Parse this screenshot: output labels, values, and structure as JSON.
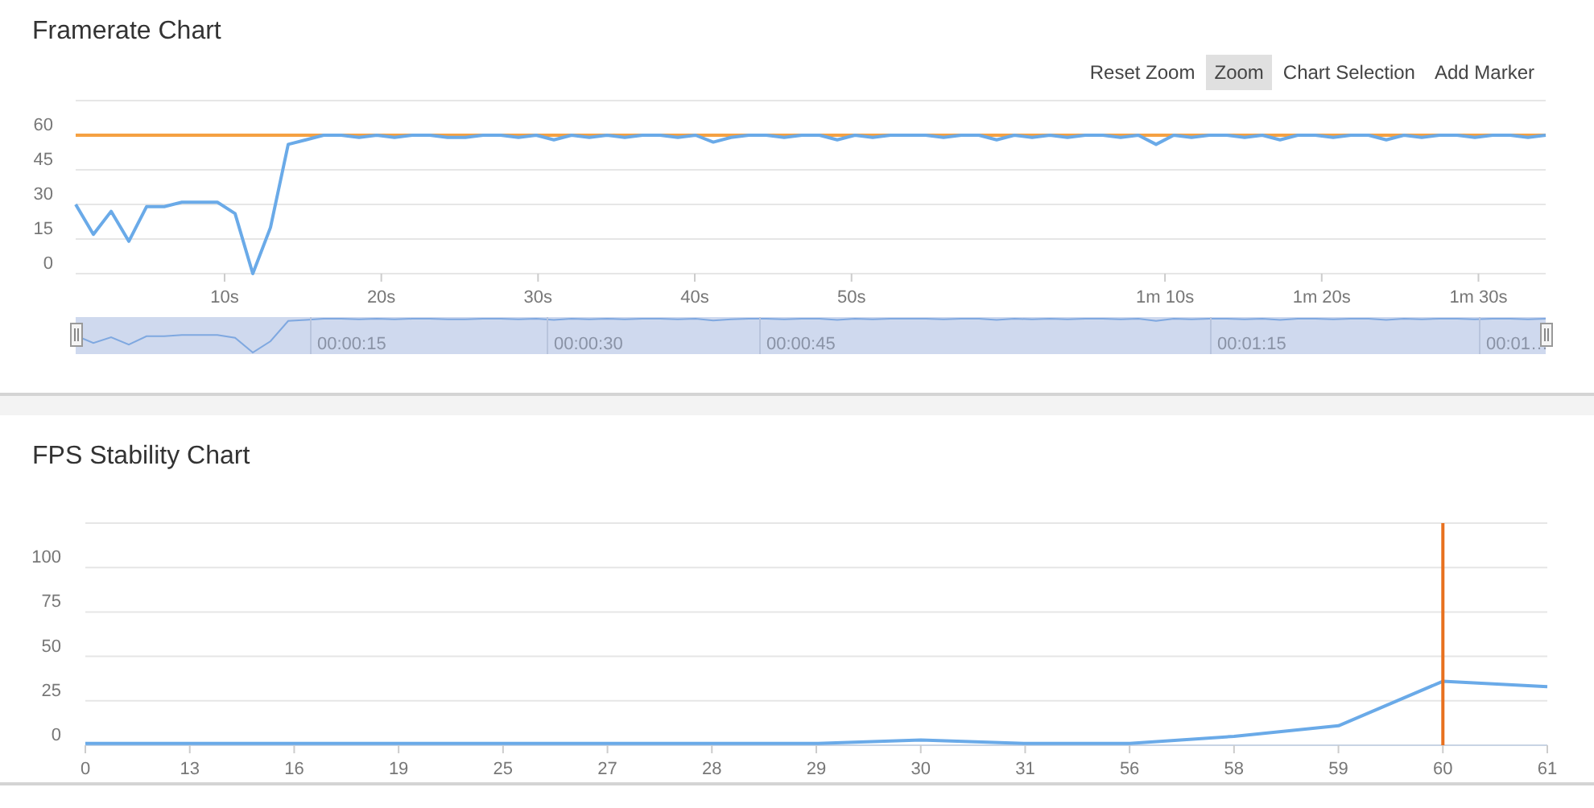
{
  "framerate_panel": {
    "title": "Framerate Chart",
    "toolbar": {
      "buttons": [
        {
          "label": "Reset Zoom",
          "selected": false
        },
        {
          "label": "Zoom",
          "selected": true
        },
        {
          "label": "Chart Selection",
          "selected": false
        },
        {
          "label": "Add Marker",
          "selected": false
        }
      ]
    },
    "chart_data": {
      "type": "line",
      "ylim": [
        0,
        75
      ],
      "yticks": [
        0,
        15,
        30,
        45,
        60
      ],
      "xlim": [
        0.5,
        94.29
      ],
      "xticks": [
        {
          "value": 10,
          "label": "10s"
        },
        {
          "value": 20,
          "label": "20s"
        },
        {
          "value": 30,
          "label": "30s"
        },
        {
          "value": 40,
          "label": "40s"
        },
        {
          "value": 50,
          "label": "50s"
        },
        {
          "value": 70,
          "label": "1m 10s"
        },
        {
          "value": 80,
          "label": "1m 20s"
        },
        {
          "value": 90,
          "label": "1m 30s"
        }
      ],
      "series": [
        {
          "color": "#6aaae8",
          "values": [
            30,
            17,
            27,
            14,
            29,
            29,
            31,
            31,
            31,
            26,
            0,
            20,
            56,
            58,
            60,
            60,
            59,
            60,
            59,
            60,
            60,
            59,
            59,
            60,
            60,
            59,
            60,
            58,
            60,
            59,
            60,
            59,
            60,
            60,
            59,
            60,
            57,
            59,
            60,
            60,
            59,
            60,
            60,
            58,
            60,
            59,
            60,
            60,
            60,
            59,
            60,
            60,
            58,
            60,
            59,
            60,
            59,
            60,
            60,
            59,
            60,
            56,
            60,
            59,
            60,
            60,
            59,
            60,
            58,
            60,
            60,
            59,
            60,
            60,
            58,
            60,
            59,
            60,
            60,
            59,
            60,
            60,
            59,
            60
          ]
        }
      ],
      "grid": true,
      "x": [
        0.5,
        1.63,
        2.76,
        3.89,
        5.02,
        6.15,
        7.28,
        8.41,
        9.54,
        10.67,
        11.8,
        12.93,
        14.06,
        15.19,
        16.32,
        17.45,
        18.58,
        19.71,
        20.84,
        21.97,
        23.1,
        24.23,
        25.36,
        26.49,
        27.62,
        28.75,
        29.88,
        31.01,
        32.14,
        33.27,
        34.4,
        35.53,
        36.66,
        37.79,
        38.92,
        40.05,
        41.18,
        42.31,
        43.44,
        44.57,
        45.7,
        46.83,
        47.96,
        49.09,
        50.22,
        51.35,
        52.48,
        53.61,
        54.74,
        55.87,
        57,
        58.13,
        59.26,
        60.39,
        61.52,
        62.65,
        63.78,
        64.91,
        66.04,
        67.17,
        68.3,
        69.43,
        70.56,
        71.69,
        72.82,
        73.95,
        75.08,
        76.21,
        77.34,
        78.47,
        79.6,
        80.73,
        81.86,
        82.99,
        84.12,
        85.25,
        86.38,
        87.51,
        88.64,
        89.77,
        90.9,
        92.03,
        93.16,
        94.29
      ],
      "ref_lines": [
        {
          "axis": "y",
          "value": 60,
          "color": "#f5a142"
        }
      ]
    },
    "navigator": {
      "labels": [
        "00:00:15",
        "00:00:30",
        "00:00:45",
        "00:01:15",
        "00:01…"
      ]
    }
  },
  "stability_panel": {
    "title": "FPS Stability Chart",
    "chart_data": {
      "type": "line",
      "ylim": [
        0,
        125
      ],
      "yticks": [
        0,
        25,
        50,
        75,
        100
      ],
      "categories": [
        "0",
        "13",
        "16",
        "19",
        "25",
        "27",
        "28",
        "29",
        "30",
        "31",
        "56",
        "58",
        "59",
        "60",
        "61"
      ],
      "series": [
        {
          "color": "#6aaae8",
          "values": [
            1,
            1,
            1,
            1,
            1,
            1,
            1,
            1,
            3,
            1,
            1,
            5,
            11,
            36,
            33
          ]
        }
      ],
      "grid": true,
      "ref_lines": [
        {
          "axis": "x",
          "value": "60",
          "color": "#e8711f"
        }
      ]
    }
  }
}
